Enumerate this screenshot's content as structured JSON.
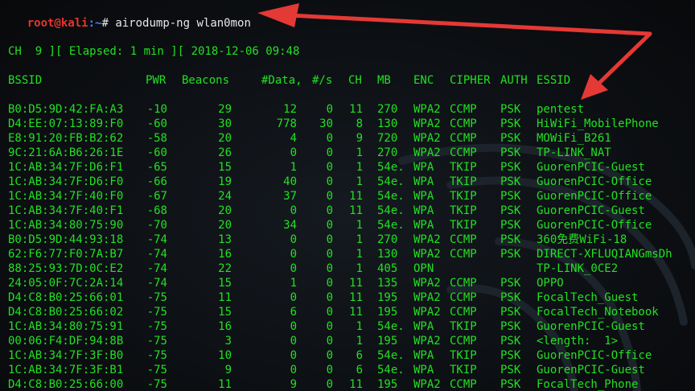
{
  "prompt": {
    "user": "root@kali",
    "path": ":~",
    "symbol": "#",
    "command": "airodump-ng wlan0mon"
  },
  "status": {
    "text": "CH  9 ][ Elapsed: 1 min ][ 2018-12-06 09:48"
  },
  "table": {
    "headers": [
      "BSSID",
      "PWR",
      "Beacons",
      "#Data,",
      "#/s",
      "CH",
      "MB",
      "ENC",
      "CIPHER",
      "AUTH",
      "ESSID"
    ],
    "rows": [
      [
        "B0:D5:9D:42:FA:A3",
        "-10",
        "29",
        "12",
        "0",
        "11",
        "270",
        "WPA2",
        "CCMP",
        "PSK",
        "pentest"
      ],
      [
        "D4:EE:07:13:89:F0",
        "-60",
        "30",
        "778",
        "30",
        "8",
        "130",
        "WPA2",
        "CCMP",
        "PSK",
        "HiWiFi_MobilePhone"
      ],
      [
        "E8:91:20:FB:B2:62",
        "-58",
        "20",
        "4",
        "0",
        "9",
        "720",
        "WPA2",
        "CCMP",
        "PSK",
        "MOWiFi_B261"
      ],
      [
        "9C:21:6A:B6:26:1E",
        "-60",
        "26",
        "0",
        "0",
        "1",
        "270",
        "WPA2",
        "CCMP",
        "PSK",
        "TP-LINK_NAT"
      ],
      [
        "1C:AB:34:7F:D6:F1",
        "-65",
        "15",
        "1",
        "0",
        "1",
        "54e.",
        "WPA",
        "TKIP",
        "PSK",
        "GuorenPCIC-Guest"
      ],
      [
        "1C:AB:34:7F:D6:F0",
        "-66",
        "19",
        "40",
        "0",
        "1",
        "54e.",
        "WPA",
        "TKIP",
        "PSK",
        "GuorenPCIC-Office"
      ],
      [
        "1C:AB:34:7F:40:F0",
        "-67",
        "24",
        "37",
        "0",
        "11",
        "54e.",
        "WPA",
        "TKIP",
        "PSK",
        "GuorenPCIC-Office"
      ],
      [
        "1C:AB:34:7F:40:F1",
        "-68",
        "20",
        "0",
        "0",
        "11",
        "54e.",
        "WPA",
        "TKIP",
        "PSK",
        "GuorenPCIC-Guest"
      ],
      [
        "1C:AB:34:80:75:90",
        "-70",
        "20",
        "34",
        "0",
        "1",
        "54e.",
        "WPA",
        "TKIP",
        "PSK",
        "GuorenPCIC-Office"
      ],
      [
        "B0:D5:9D:44:93:18",
        "-74",
        "13",
        "0",
        "0",
        "1",
        "270",
        "WPA2",
        "CCMP",
        "PSK",
        "360免费WiFi-18"
      ],
      [
        "62:F6:77:F0:7A:B7",
        "-74",
        "16",
        "0",
        "0",
        "1",
        "130",
        "WPA2",
        "CCMP",
        "PSK",
        "DIRECT-XFLUQIANGmsDh"
      ],
      [
        "88:25:93:7D:0C:E2",
        "-74",
        "22",
        "0",
        "0",
        "1",
        "405",
        "OPN",
        "",
        "",
        "TP-LINK_0CE2"
      ],
      [
        "24:05:0F:7C:2A:14",
        "-74",
        "15",
        "1",
        "0",
        "11",
        "135",
        "WPA2",
        "CCMP",
        "PSK",
        "OPPO"
      ],
      [
        "D4:C8:B0:25:66:01",
        "-75",
        "11",
        "0",
        "0",
        "11",
        "195",
        "WPA2",
        "CCMP",
        "PSK",
        "FocalTech_Guest"
      ],
      [
        "D4:C8:B0:25:66:02",
        "-75",
        "15",
        "6",
        "0",
        "11",
        "195",
        "WPA2",
        "CCMP",
        "PSK",
        "FocalTech_Notebook"
      ],
      [
        "1C:AB:34:80:75:91",
        "-75",
        "16",
        "0",
        "0",
        "1",
        "54e.",
        "WPA",
        "TKIP",
        "PSK",
        "GuorenPCIC-Guest"
      ],
      [
        "00:06:F4:DF:94:8B",
        "-75",
        "3",
        "0",
        "0",
        "1",
        "195",
        "WPA2",
        "CCMP",
        "PSK",
        "<length:  1>"
      ],
      [
        "1C:AB:34:7F:3F:B0",
        "-75",
        "10",
        "0",
        "0",
        "6",
        "54e.",
        "WPA",
        "TKIP",
        "PSK",
        "GuorenPCIC-Office"
      ],
      [
        "1C:AB:34:7F:3F:B1",
        "-75",
        "9",
        "0",
        "0",
        "6",
        "54e.",
        "WPA",
        "TKIP",
        "PSK",
        "GuorenPCIC-Guest"
      ],
      [
        "D4:C8:B0:25:66:00",
        "-75",
        "11",
        "9",
        "0",
        "11",
        "195",
        "WPA2",
        "CCMP",
        "PSK",
        "FocalTech_Phone"
      ]
    ]
  },
  "annotations": {
    "arrow_color": "#e53935"
  },
  "colors": {
    "terminal_text": "#22e022",
    "prompt_user": "#e8342c",
    "prompt_path": "#4f7dff",
    "command_text": "#e8e8e8",
    "background": "#0d1014"
  }
}
